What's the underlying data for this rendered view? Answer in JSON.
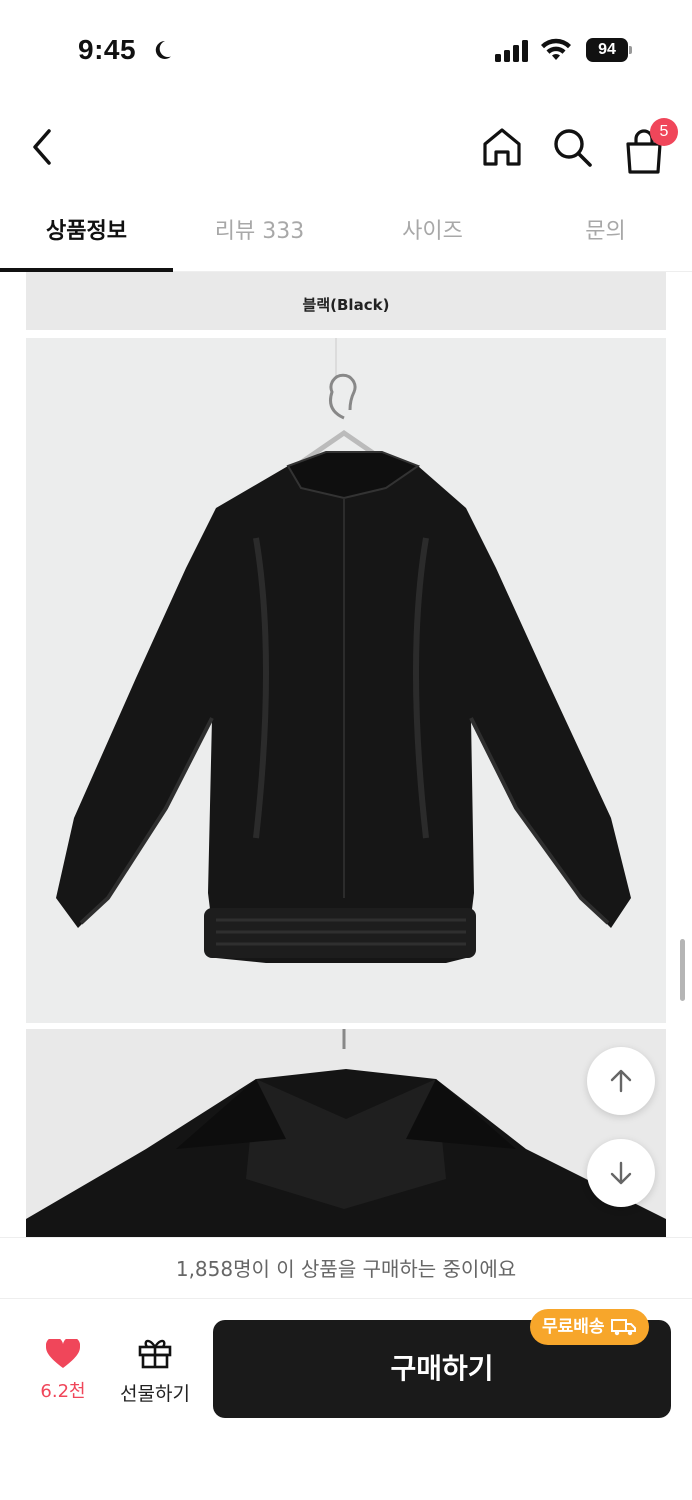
{
  "status_bar": {
    "time": "9:45",
    "battery": "94"
  },
  "header": {
    "cart_count": "5"
  },
  "tabs": [
    {
      "label": "상품정보",
      "active": true
    },
    {
      "label": "리뷰 333",
      "active": false
    },
    {
      "label": "사이즈",
      "active": false
    },
    {
      "label": "문의",
      "active": false
    }
  ],
  "content": {
    "color_label": "블랙(Black)"
  },
  "purchase_notice": "1,858명이 이 상품을 구매하는 중이에요",
  "bottom": {
    "like_count": "6.2천",
    "gift_label": "선물하기",
    "buy_label": "구매하기",
    "free_shipping": "무료배송"
  },
  "colors": {
    "accent_red": "#f0465a",
    "badge_orange": "#f7a62b",
    "buy_bg": "#1a1a1a"
  }
}
